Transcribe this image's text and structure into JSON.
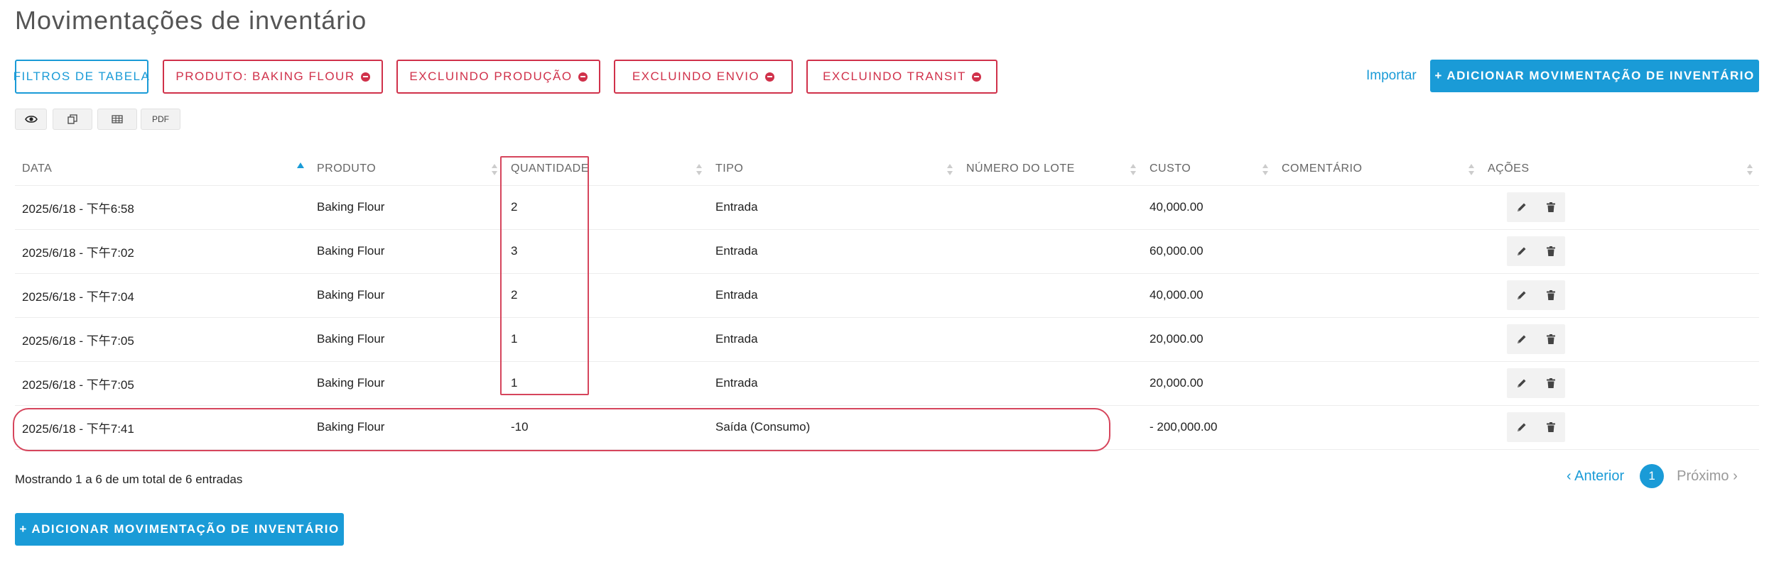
{
  "page": {
    "title": "Movimentações de inventário"
  },
  "toolbar": {
    "filters_label": "FILTROS DE TABELA",
    "chips": [
      "PRODUTO: BAKING FLOUR",
      "EXCLUINDO PRODUÇÃO",
      "EXCLUINDO ENVIO",
      "EXCLUINDO TRANSIT"
    ],
    "import_label": "Importar",
    "add_label": "+ ADICIONAR MOVIMENTAÇÃO DE INVENTÁRIO",
    "export_buttons": [
      {
        "icon": "eye-icon"
      },
      {
        "icon": "copy-icon"
      },
      {
        "icon": "table-icon"
      },
      {
        "icon": "pdf-icon",
        "label": "PDF"
      }
    ]
  },
  "table": {
    "columns": [
      "DATA",
      "PRODUTO",
      "QUANTIDADE",
      "TIPO",
      "NÚMERO DO LOTE",
      "CUSTO",
      "COMENTÁRIO",
      "AÇÕES"
    ],
    "rows": [
      [
        "2025/6/18 - 下午6:58",
        "Baking Flour",
        "2",
        "Entrada",
        "",
        "40,000.00",
        ""
      ],
      [
        "2025/6/18 - 下午7:02",
        "Baking Flour",
        "3",
        "Entrada",
        "",
        "60,000.00",
        ""
      ],
      [
        "2025/6/18 - 下午7:04",
        "Baking Flour",
        "2",
        "Entrada",
        "",
        "40,000.00",
        ""
      ],
      [
        "2025/6/18 - 下午7:05",
        "Baking Flour",
        "1",
        "Entrada",
        "",
        "20,000.00",
        ""
      ],
      [
        "2025/6/18 - 下午7:05",
        "Baking Flour",
        "1",
        "Entrada",
        "",
        "20,000.00",
        ""
      ],
      [
        "2025/6/18 - 下午7:41",
        "Baking Flour",
        "-10",
        "Saída (Consumo)",
        "",
        "- 200,000.00",
        ""
      ]
    ]
  },
  "footer": {
    "info": "Mostrando 1 a 6 de um total de 6 entradas",
    "prev_label": "‹ Anterior",
    "current_page": "1",
    "next_label": "Próximo ›",
    "add_label": "+ ADICIONAR MOVIMENTAÇÃO DE INVENTÁRIO"
  },
  "colors": {
    "accent": "#1a9bd7",
    "danger": "#d0314a",
    "highlight": "#d6455c"
  }
}
